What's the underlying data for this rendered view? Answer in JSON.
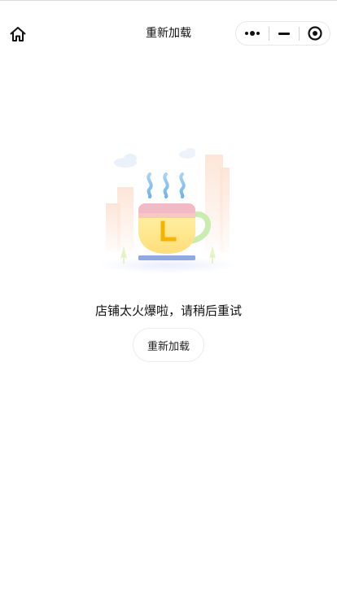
{
  "navbar": {
    "title": "重新加载",
    "home_icon": "home-icon",
    "capsule": {
      "more_icon": "more-dots-icon",
      "minimize_icon": "minus-icon",
      "close_icon": "target-circle-icon"
    }
  },
  "main": {
    "illustration_icon": "coffee-cup-city-illustration",
    "message": "店铺太火爆啦，请稍后重试",
    "reload_label": "重新加载"
  },
  "colors": {
    "cup_body": "#ffe488",
    "cup_rim": "#f4b9c6",
    "cup_handle": "#c9ecb0",
    "steam": "#86c3f0",
    "saucer": "#8fa9e6",
    "clock_hand": "#f4b400",
    "buildings": "#fde4d6"
  }
}
